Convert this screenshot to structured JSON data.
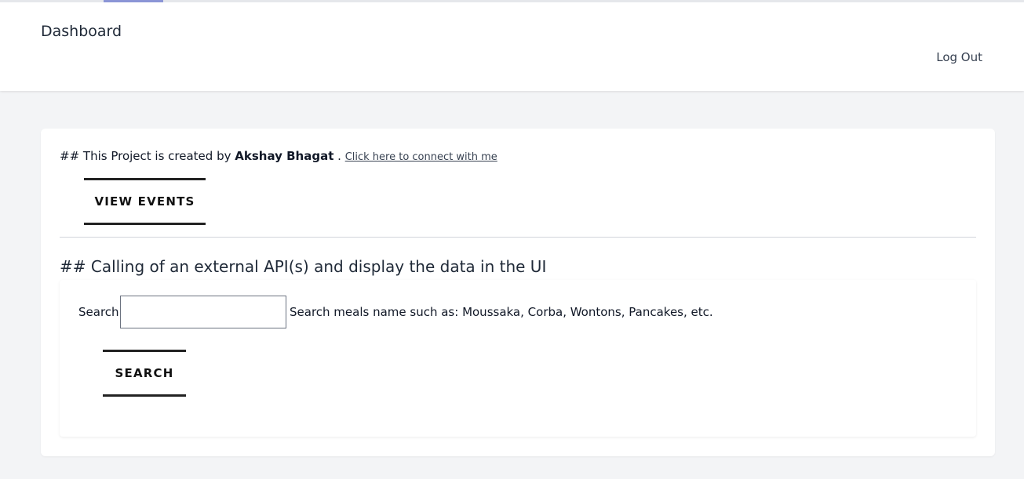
{
  "header": {
    "title": "Dashboard",
    "logout_label": "Log Out"
  },
  "intro": {
    "prefix": "## This Project is created by ",
    "author": "Akshay Bhagat",
    "separator": " . ",
    "link_text": "Click here to connect with me"
  },
  "buttons": {
    "view_events": "VIEW EVENTS",
    "search": "SEARCH"
  },
  "section": {
    "heading": "## Calling of an external API(s) and display the data in the UI"
  },
  "search": {
    "label": "Search",
    "value": "",
    "hint": "Search meals name such as: Moussaka, Corba, Wontons, Pancakes, etc."
  },
  "colors": {
    "background": "#f3f4f6",
    "panel": "#ffffff",
    "active_tab": "#8b95d6",
    "button_border": "#222222"
  }
}
